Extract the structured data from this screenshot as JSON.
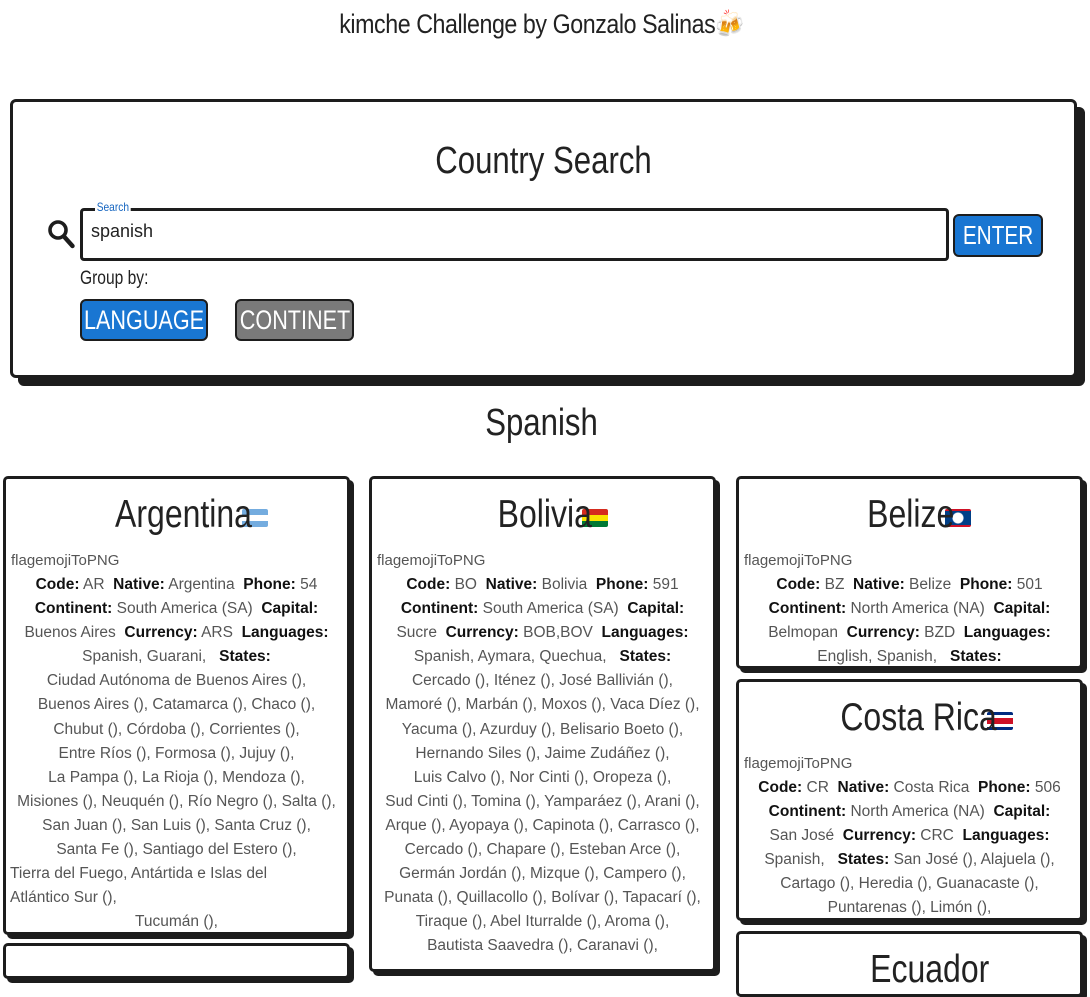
{
  "app": {
    "title": "kimche Challenge by Gonzalo Salinas",
    "title_emoji": "🍻"
  },
  "search_panel": {
    "title": "Country Search",
    "search_label": "Search",
    "search_value": "spanish",
    "enter_label": "ENTER",
    "group_by_label": "Group by:",
    "group_buttons": [
      "LANGUAGE",
      "CONTINET"
    ],
    "active_group": "LANGUAGE"
  },
  "group_title": "Spanish",
  "field_labels": {
    "code": "Code:",
    "native": "Native:",
    "phone": "Phone:",
    "continent": "Continent:",
    "capital": "Capital:",
    "currency": "Currency:",
    "languages": "Languages:",
    "states": "States:"
  },
  "image_alt": "flagemojiToPNG",
  "countries": [
    {
      "name": "Argentina",
      "code": "AR",
      "native": "Argentina",
      "phone": "54",
      "continent": "South America (SA)",
      "capital": "Buenos Aires",
      "currency": "ARS",
      "languages": "Spanish, Guarani,",
      "states_lines": [
        "Ciudad Autónoma de Buenos Aires (),",
        "Buenos Aires (), Catamarca (), Chaco (),",
        "Chubut (), Córdoba (), Corrientes (),",
        "Entre Ríos (), Formosa (), Jujuy (),",
        "La Pampa (), La Rioja (), Mendoza (),",
        "Misiones (), Neuquén (), Río Negro (), Salta (),",
        "San Juan (), San Luis (), Santa Cruz (),",
        "Santa Fe (), Santiago del Estero (),",
        "Tierra del Fuego, Antártida e Islas del",
        "Atlántico Sur (),",
        "Tucumán (),"
      ]
    },
    {
      "name": "Bolivia",
      "code": "BO",
      "native": "Bolivia",
      "phone": "591",
      "continent": "South America (SA)",
      "capital": "Sucre",
      "currency": "BOB,BOV",
      "languages": "Spanish, Aymara, Quechua,",
      "states_lines": [
        "Cercado (), Iténez (), José Ballivián (),",
        "Mamoré (), Marbán (), Moxos (), Vaca Díez (),",
        "Yacuma (), Azurduy (), Belisario Boeto (),",
        "Hernando Siles (), Jaime Zudáñez (),",
        "Luis Calvo (), Nor Cinti (), Oropeza (),",
        "Sud Cinti (), Tomina (), Yamparáez (), Arani (),",
        "Arque (), Ayopaya (), Capinota (), Carrasco (),",
        "Cercado (), Chapare (), Esteban Arce (),",
        "Germán Jordán (), Mizque (), Campero (),",
        "Punata (), Quillacollo (), Bolívar (), Tapacarí (),",
        "Tiraque (), Abel Iturralde (), Aroma (),",
        "Bautista Saavedra (), Caranavi (),"
      ]
    },
    {
      "name": "Belize",
      "code": "BZ",
      "native": "Belize",
      "phone": "501",
      "continent": "North America (NA)",
      "capital": "Belmopan",
      "currency": "BZD",
      "languages": "English, Spanish,",
      "states_lines": []
    },
    {
      "name": "Costa Rica",
      "code": "CR",
      "native": "Costa Rica",
      "phone": "506",
      "continent": "North America (NA)",
      "capital": "San José",
      "currency": "CRC",
      "languages": "Spanish,",
      "states_inline": "San José (), Alajuela (),",
      "states_lines": [
        "Cartago (), Heredia (), Guanacaste (),",
        "Puntarenas (), Limón (),"
      ]
    },
    {
      "name": "Ecuador"
    }
  ]
}
